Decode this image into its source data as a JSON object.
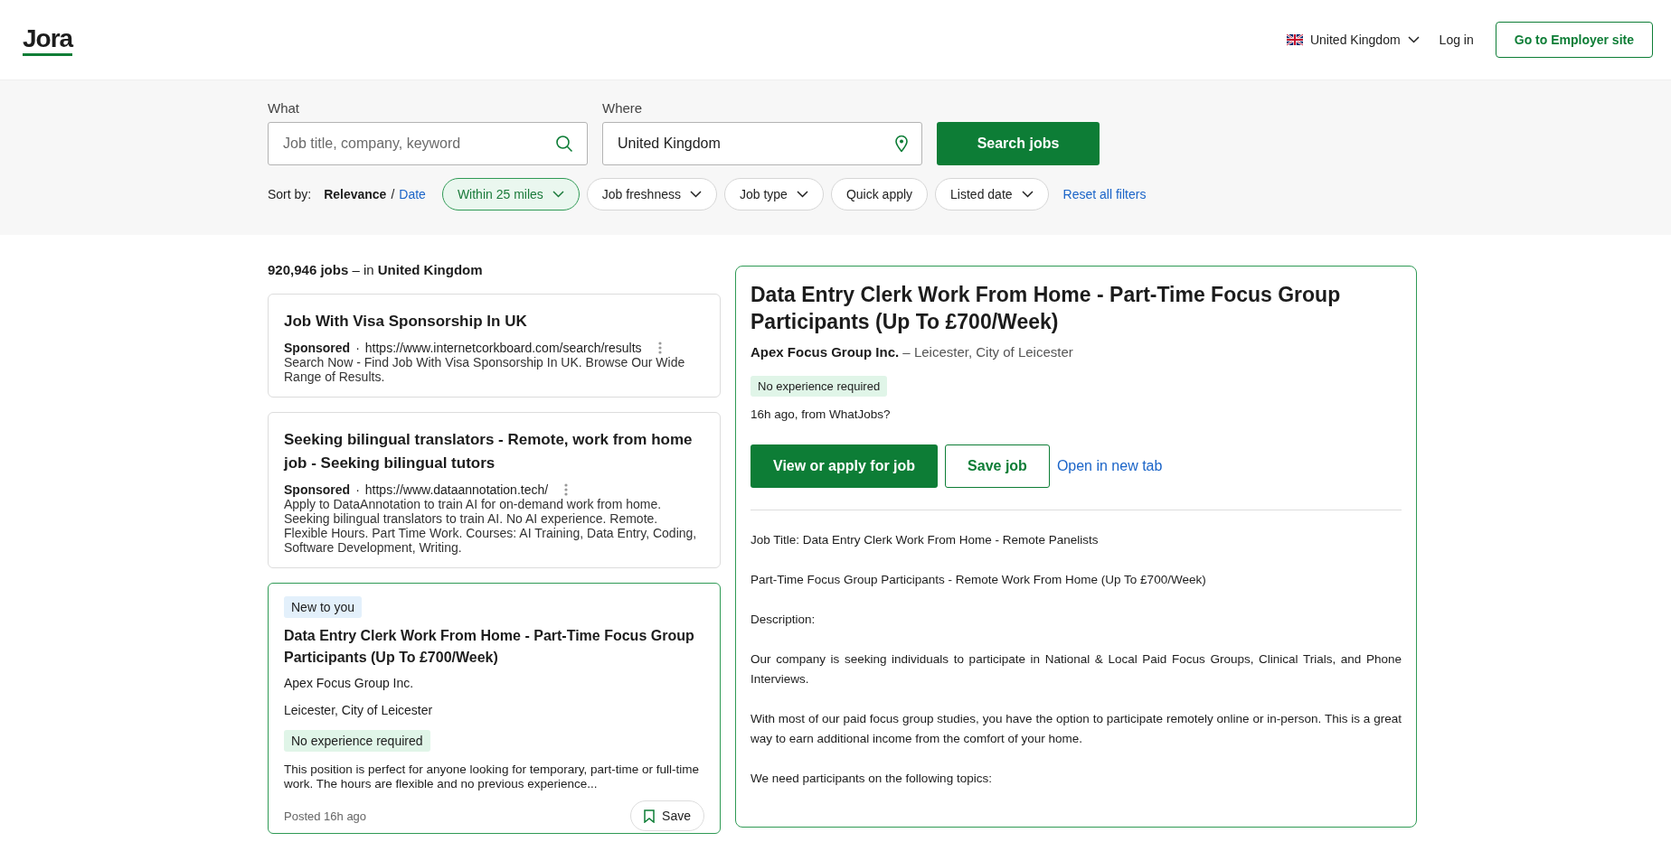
{
  "header": {
    "logo": "Jora",
    "country": "United Kingdom",
    "login": "Log in",
    "employer_button": "Go to Employer site"
  },
  "search": {
    "what": {
      "label": "What",
      "placeholder": "Job title, company, keyword"
    },
    "where": {
      "label": "Where",
      "value": "United Kingdom"
    },
    "button": "Search jobs",
    "sort": {
      "label": "Sort by:",
      "separator": "/",
      "options": [
        {
          "label": "Relevance",
          "selected": true
        },
        {
          "label": "Date",
          "selected": false
        }
      ]
    },
    "filters": [
      {
        "label": "Within 25 miles",
        "kind": "dropdown",
        "selected": true
      },
      {
        "label": "Job freshness",
        "kind": "dropdown",
        "selected": false
      },
      {
        "label": "Job type",
        "kind": "dropdown",
        "selected": false
      },
      {
        "label": "Quick apply",
        "kind": "toggle",
        "selected": false
      },
      {
        "label": "Listed date",
        "kind": "dropdown",
        "selected": false
      }
    ],
    "reset": "Reset all filters"
  },
  "results": {
    "summary": "**920,946 jobs** – in **United Kingdom**",
    "ads": [
      {
        "title": "Job With Visa Sponsorship In UK",
        "label": "Sponsored",
        "separator": "·",
        "url": "https://www.internetcorkboard.com/search/results",
        "description": "Search Now - Find Job With Visa Sponsorship In UK. Browse Our Wide Range of Results."
      },
      {
        "title": "Seeking bilingual translators - Remote, work from home job - Seeking bilingual tutors",
        "label": "Sponsored",
        "separator": "·",
        "url": "https://www.dataannotation.tech/",
        "description": "Apply to DataAnnotation to train AI for on-demand work from home. Seeking bilingual translators to train AI. No AI experience. Remote. Flexible Hours. Part Time Work. Courses: AI Training, Data Entry, Coding, Software Development, Writing."
      }
    ],
    "jobs": [
      {
        "badge": "New to you",
        "title": "Data Entry Clerk Work From Home - Part-Time Focus Group Participants (Up To £700/Week)",
        "company": "Apex Focus Group Inc.",
        "location": "Leicester, City of Leicester",
        "tag": "No experience required",
        "snippet": "This position is perfect for anyone looking for temporary, part-time or full-time work. The hours are flexible and no previous experience...",
        "posted": "Posted 16h ago",
        "save": "Save",
        "selected": true
      }
    ]
  },
  "detail": {
    "title": "Data Entry Clerk Work From Home - Part-Time Focus Group Participants (Up To £700/Week)",
    "company": "Apex Focus Group Inc.",
    "separator": "–",
    "location": "Leicester, City of Leicester",
    "tag": "No experience required",
    "meta": "16h ago, from WhatJobs?",
    "apply_button": "View or apply for job",
    "save_button": "Save job",
    "open_link": "Open in new tab",
    "paragraphs": [
      "Job Title: Data Entry Clerk Work From Home - Remote Panelists",
      "Part-Time Focus Group Participants - Remote Work From Home (Up To £700/Week)",
      "Description:",
      "Our company is seeking individuals to participate in National & Local Paid Focus Groups, Clinical Trials, and Phone Interviews.",
      "With most of our paid focus group studies, you have the option to participate remotely online or in-person. This is a great way to earn additional income from the comfort of your home.",
      "We need participants on the following topics:"
    ]
  }
}
